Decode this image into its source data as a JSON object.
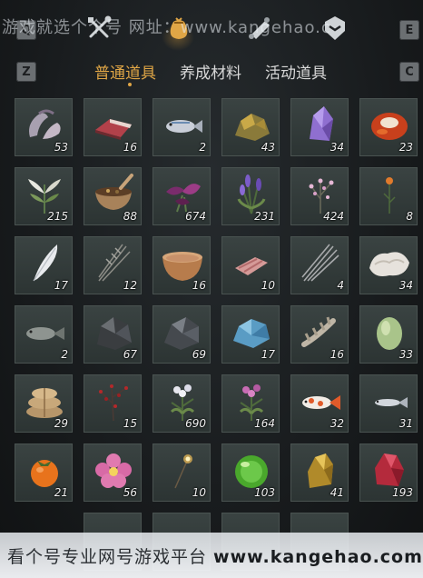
{
  "watermark_top": "游戏就选个个号 网址：www.kangehao.c",
  "keys": {
    "q": "Q",
    "e": "E",
    "z": "Z",
    "c": "C"
  },
  "toolbar": {
    "icons": [
      "crossed-tools-icon",
      "pouch-icon",
      "scroll-icon",
      "shield-icon"
    ],
    "active_index": 1,
    "accent_color": "#e0a646"
  },
  "tabs": [
    {
      "label": "普通道具",
      "active": true
    },
    {
      "label": "养成材料",
      "active": false
    },
    {
      "label": "活动道具",
      "active": false
    }
  ],
  "items": [
    {
      "name": "raw-meat-pieces",
      "qty": "53"
    },
    {
      "name": "red-meat-slab",
      "qty": "16"
    },
    {
      "name": "silver-fish",
      "qty": "2"
    },
    {
      "name": "gold-ore",
      "qty": "43"
    },
    {
      "name": "purple-crystal",
      "qty": "34"
    },
    {
      "name": "red-agate",
      "qty": "23"
    },
    {
      "name": "white-herb",
      "qty": "215"
    },
    {
      "name": "herb-mortar",
      "qty": "88"
    },
    {
      "name": "purple-flower-bunch",
      "qty": "674"
    },
    {
      "name": "lavender-herb",
      "qty": "231"
    },
    {
      "name": "pink-blossom-herb",
      "qty": "424"
    },
    {
      "name": "orange-flower",
      "qty": "8"
    },
    {
      "name": "white-feather",
      "qty": "17"
    },
    {
      "name": "dry-grass-bundle",
      "qty": "12"
    },
    {
      "name": "clay-bowl",
      "qty": "16"
    },
    {
      "name": "raw-meat-strips",
      "qty": "10"
    },
    {
      "name": "quills",
      "qty": "4"
    },
    {
      "name": "white-fur",
      "qty": "34"
    },
    {
      "name": "grey-fish",
      "qty": "2"
    },
    {
      "name": "dark-ore",
      "qty": "67"
    },
    {
      "name": "iron-ore",
      "qty": "69"
    },
    {
      "name": "blue-crystal-ore",
      "qty": "17"
    },
    {
      "name": "spine-bone",
      "qty": "16"
    },
    {
      "name": "green-melon",
      "qty": "33"
    },
    {
      "name": "rice-sacks",
      "qty": "29"
    },
    {
      "name": "red-berry-branch",
      "qty": "15"
    },
    {
      "name": "white-flower-herb",
      "qty": "690"
    },
    {
      "name": "pink-flower-herb",
      "qty": "164"
    },
    {
      "name": "koi-fish",
      "qty": "32"
    },
    {
      "name": "small-fish",
      "qty": "31"
    },
    {
      "name": "persimmon",
      "qty": "21"
    },
    {
      "name": "pink-flower",
      "qty": "56"
    },
    {
      "name": "firefly-twig",
      "qty": "10"
    },
    {
      "name": "green-jade-orb",
      "qty": "103"
    },
    {
      "name": "gold-nugget",
      "qty": "41"
    },
    {
      "name": "red-gem-ore",
      "qty": "193"
    }
  ],
  "banner": {
    "text": "看个号专业网号游戏平台 ",
    "site": "www.kangehao.com"
  }
}
